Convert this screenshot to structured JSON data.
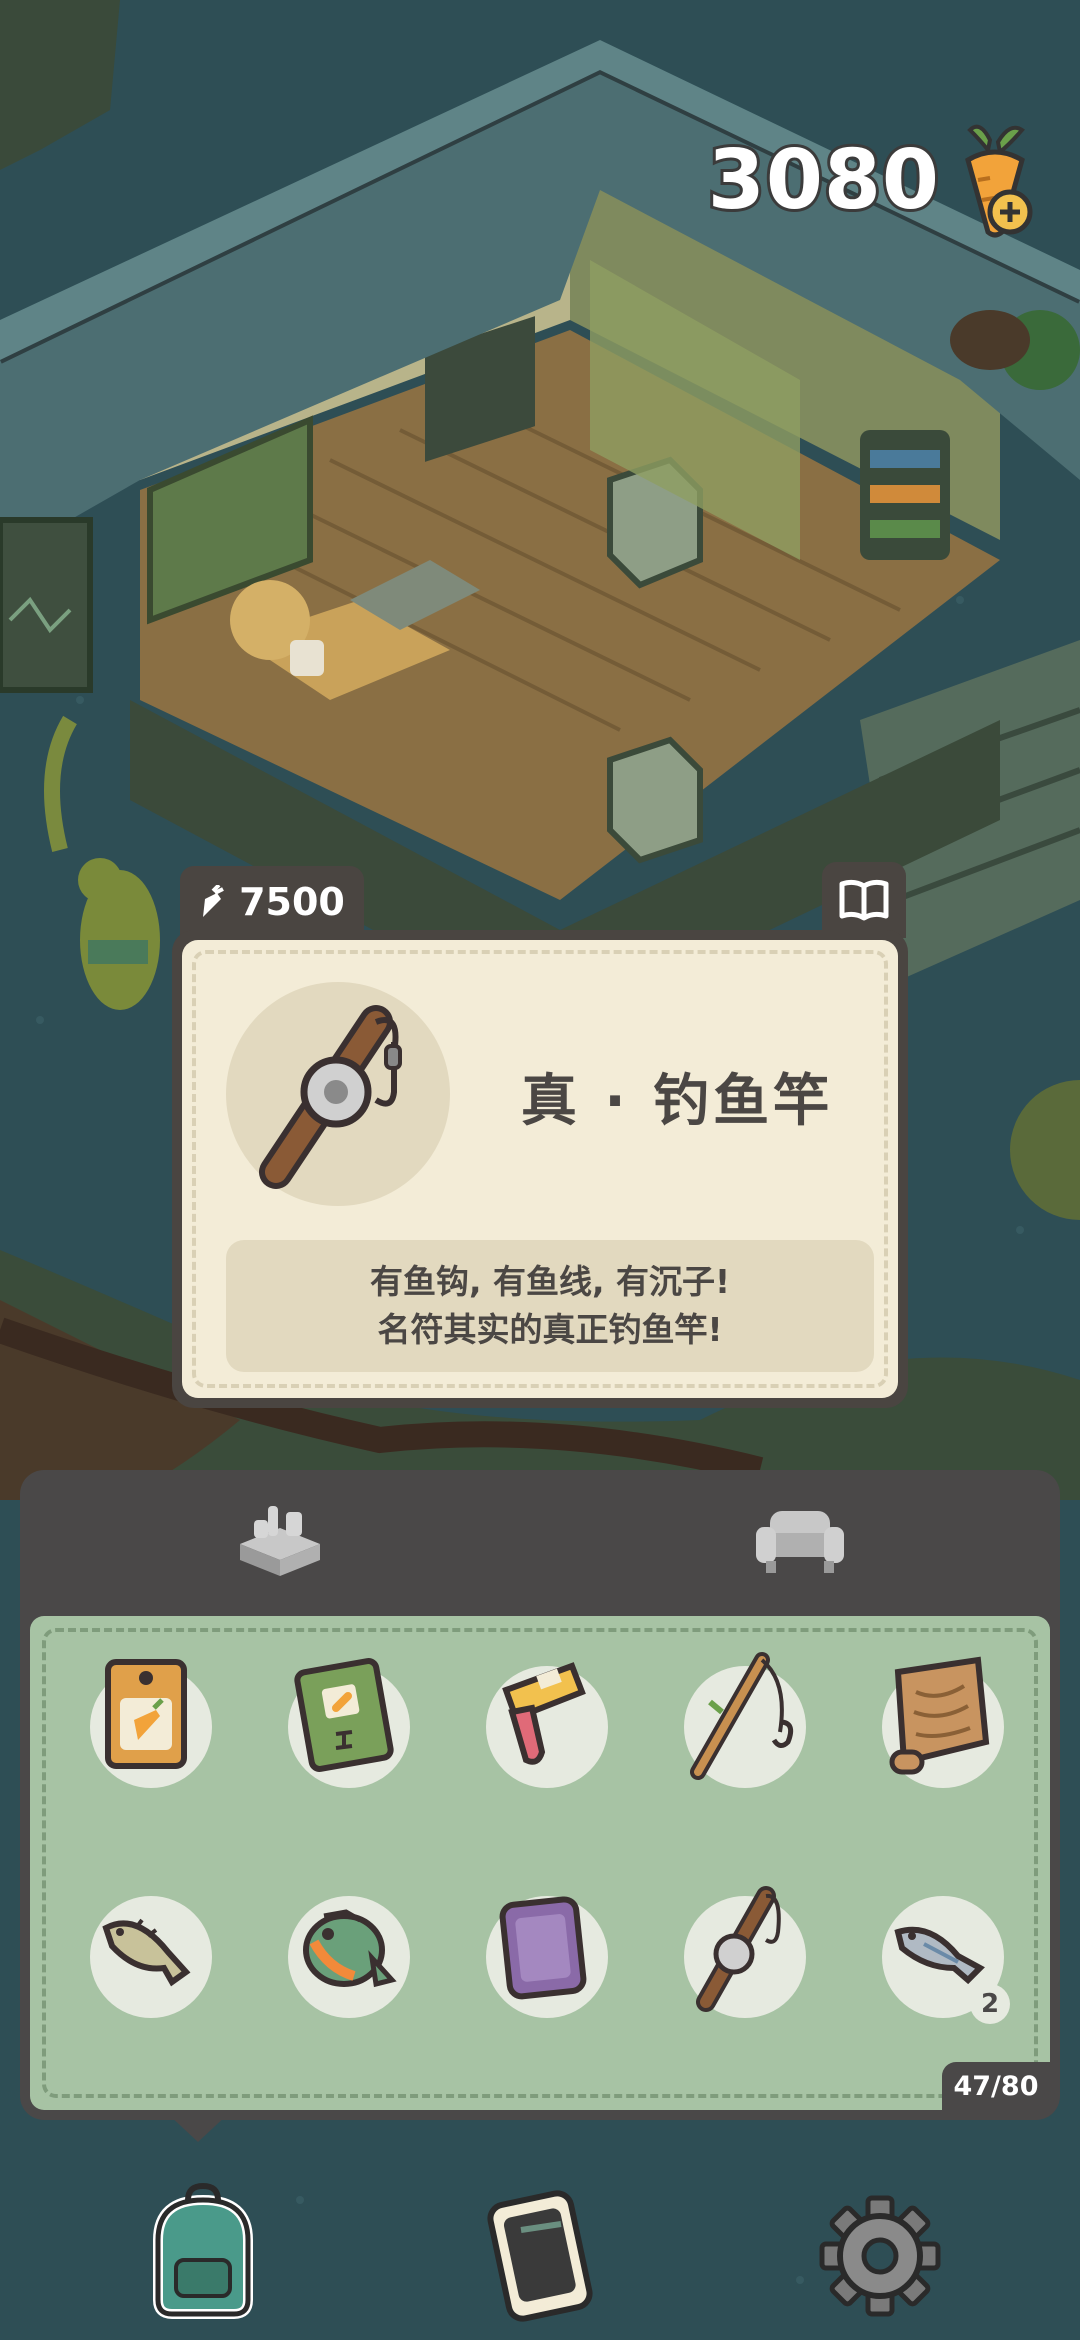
{
  "currency": {
    "value": "3080",
    "icon": "carrot-plus-icon"
  },
  "item_detail": {
    "price": "7500",
    "price_icon": "carrot-icon",
    "guide_icon": "book-icon",
    "name": "真 · 钓鱼竿",
    "description_line1": "有鱼钩, 有鱼线, 有沉子!",
    "description_line2": "名符其实的真正钓鱼竿!"
  },
  "inventory": {
    "tabs": [
      {
        "name": "build",
        "icon": "workbench-icon"
      },
      {
        "name": "furniture",
        "icon": "sofa-icon"
      }
    ],
    "capacity": "47/80",
    "items": [
      {
        "icon": "carrot-seed-packet-icon"
      },
      {
        "icon": "carrot-book-icon"
      },
      {
        "icon": "bait-pouch-icon"
      },
      {
        "icon": "simple-fishing-rod-icon"
      },
      {
        "icon": "wood-scroll-icon"
      },
      {
        "icon": "small-fish-icon"
      },
      {
        "icon": "sunfish-icon"
      },
      {
        "icon": "purple-tile-icon"
      },
      {
        "icon": "fishing-rod-icon"
      },
      {
        "icon": "silver-fish-icon",
        "count": "2"
      }
    ]
  },
  "nav": [
    {
      "name": "backpack",
      "icon": "backpack-icon"
    },
    {
      "name": "phone",
      "icon": "phone-icon"
    },
    {
      "name": "settings",
      "icon": "gear-icon"
    }
  ],
  "colors": {
    "panel_dark": "#4a4848",
    "card_bg": "#f3ecd7",
    "grid_bg": "#a7c3a4",
    "water": "#2f4f55"
  }
}
